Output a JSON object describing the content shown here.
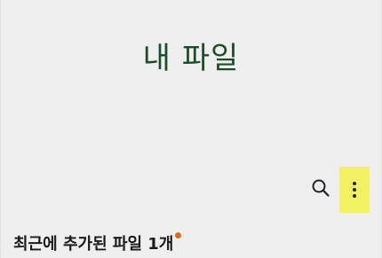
{
  "header": {
    "title": "내 파일"
  },
  "toolbar": {
    "search_icon": "search-icon",
    "more_icon": "more-vertical-icon"
  },
  "recent": {
    "label": "최근에 추가된 파일 1개",
    "badge_color": "#e26a1a"
  },
  "colors": {
    "title": "#1b4d2a",
    "background": "#efefef",
    "highlight": "#f3f064"
  }
}
